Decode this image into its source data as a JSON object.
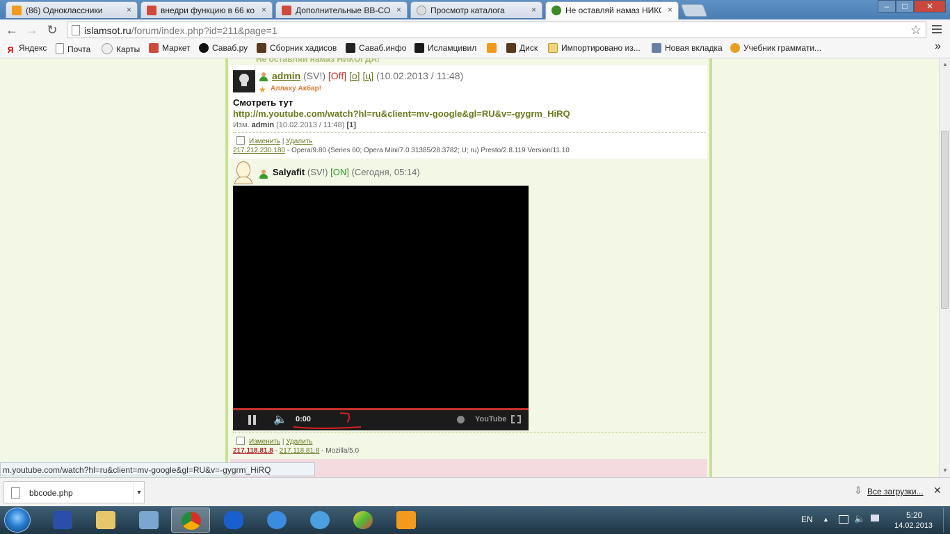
{
  "browser": {
    "tabs": [
      {
        "label": "(86) Одноклассники",
        "icon": "odnoklassniki-icon",
        "active": false
      },
      {
        "label": "внедри функцию в 66 ко",
        "icon": "cms-icon",
        "active": false
      },
      {
        "label": "Дополнительные BB-COI",
        "icon": "cms-icon",
        "active": false
      },
      {
        "label": "Просмотр каталога",
        "icon": "globe-icon",
        "active": false
      },
      {
        "label": "Не оставляй намаз НИКО",
        "icon": "site-icon",
        "active": true
      }
    ],
    "tab_close": "×",
    "window_buttons": {
      "minimize": "–",
      "maximize": "□",
      "close": "✕"
    },
    "address": {
      "host": "islamsot.ru",
      "path": "/forum/index.php?id=211&page=1"
    },
    "bookmarks": [
      {
        "label": "Яндекс",
        "icon": "yandex-icon"
      },
      {
        "label": "Почта",
        "icon": "page-icon"
      },
      {
        "label": "Карты",
        "icon": "globe-icon"
      },
      {
        "label": "Маркет",
        "icon": "cms-icon"
      },
      {
        "label": "Саваб.ру",
        "icon": "savab-icon"
      },
      {
        "label": "Сборник хадисов",
        "icon": "book-icon"
      },
      {
        "label": "Саваб.инфо",
        "icon": "savab-info-icon"
      },
      {
        "label": "Исламцивил",
        "icon": "islamcivil-icon"
      },
      {
        "label": "",
        "icon": "odnoklassniki-icon"
      },
      {
        "label": "Диск",
        "icon": "disk-icon"
      },
      {
        "label": "Импортировано из...",
        "icon": "folder-icon"
      },
      {
        "label": "Новая вкладка",
        "icon": "image-icon"
      },
      {
        "label": "Учебник граммати...",
        "icon": "joomla-icon"
      }
    ],
    "bookmarks_overflow": "»",
    "status_url": "m.youtube.com/watch?hl=ru&client=mv-google&gl=RU&v=-gygrm_HiRQ"
  },
  "forum": {
    "topic_title_partial": "Не оставляй намаз НИКОГДА!",
    "post1": {
      "author": "admin",
      "sv": "(SV!)",
      "status": "[Off]",
      "link_o": "[о]",
      "link_c": "[ц]",
      "datetime": "(10.02.2013 / 11:48)",
      "rank": "Аллаху Акбар!",
      "text": "Смотреть тут",
      "url": "http://m.youtube.com/watch?hl=ru&client=mv-google&gl=RU&v=-gygrm_HiRQ",
      "edited_label": "Изм.",
      "edited_by": "admin",
      "edited_datetime": "(10.02.2013 / 11:48)",
      "edited_count": "[1]",
      "edit_link": "Изменить",
      "separator": "|",
      "delete_link": "Удалить",
      "ip": "217.212.230.180",
      "useragent": "- Opera/9.80 (Series 60; Opera Mini/7.0.31385/28.3782; U; ru) Presto/2.8.119 Version/11.10"
    },
    "post2": {
      "author": "Salyafit",
      "sv": "(SV!)",
      "status": "[ON]",
      "datetime": "(Сегодня, 05:14)",
      "video_time": "0:00",
      "video_logo": "YouTube",
      "edit_link": "Изменить",
      "separator": "|",
      "delete_link": "Удалить",
      "ip1": "217.118.81.8",
      "ip_sep": " - ",
      "ip2": "217.118.81.8",
      "useragent": "- Mozilla/5.0"
    }
  },
  "downloads": {
    "file": "bbcode.php",
    "all_downloads": "Все загрузки...",
    "close": "✕"
  },
  "taskbar": {
    "apps": [
      "floppy-icon",
      "explorer-icon",
      "network-icon",
      "chrome-icon",
      "bluetooth-icon",
      "ie-icon",
      "mail-icon",
      "ball-icon",
      "odnoklassniki-icon"
    ],
    "lang": "EN",
    "time": "5:20",
    "date": "14.02.2013"
  },
  "colors": {
    "accent_green": "#c8e094",
    "link_olive": "#6a7a1e",
    "status_red": "#c9302c",
    "status_green": "#2c9a1e"
  }
}
